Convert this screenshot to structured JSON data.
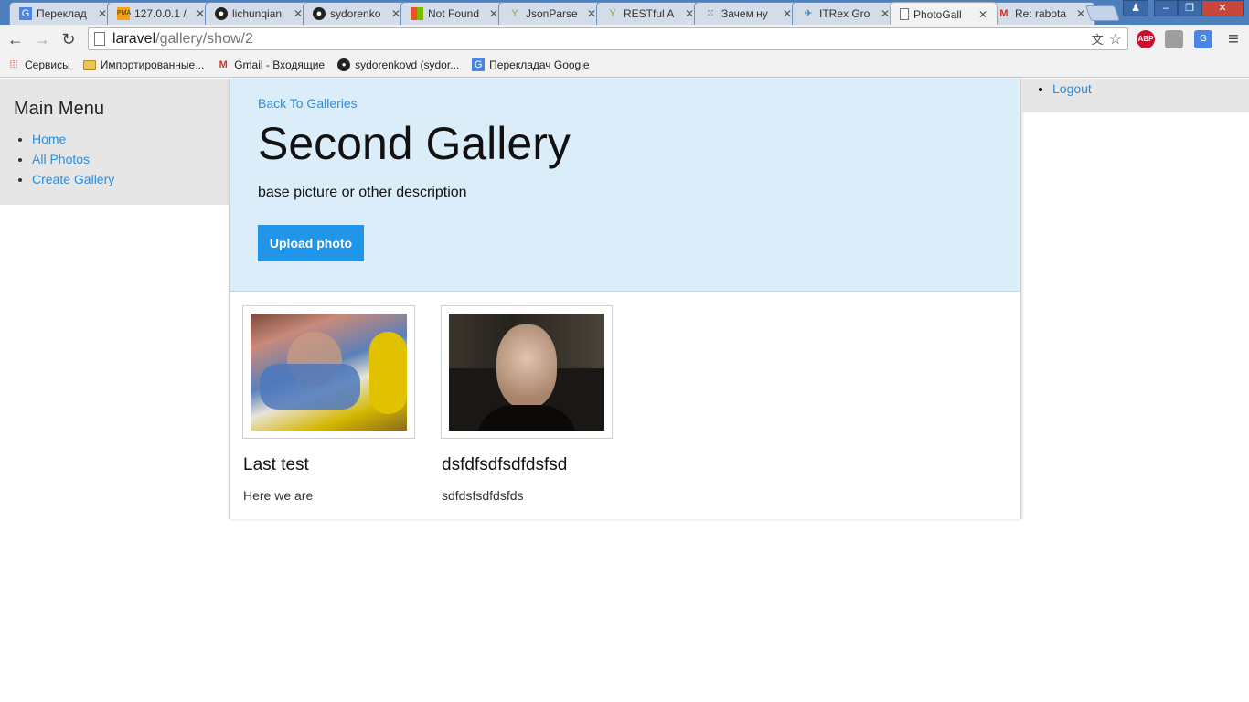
{
  "browser": {
    "tabs": [
      {
        "title": "Переклад",
        "icon": "google-translate-icon"
      },
      {
        "title": "127.0.0.1 /",
        "icon": "phpmyadmin-icon"
      },
      {
        "title": "lichunqian",
        "icon": "github-icon"
      },
      {
        "title": "sydorenko",
        "icon": "github-icon"
      },
      {
        "title": "Not Found",
        "icon": "microsoft-icon"
      },
      {
        "title": "JsonParse",
        "icon": "yii-icon"
      },
      {
        "title": "RESTful A",
        "icon": "yii-icon"
      },
      {
        "title": "Зачем ну",
        "icon": "habr-icon"
      },
      {
        "title": "ITRex Gro",
        "icon": "itrex-icon"
      },
      {
        "title": "PhotoGall",
        "icon": "page-icon"
      },
      {
        "title": "Re: rabota",
        "icon": "gmail-icon"
      }
    ],
    "active_tab_index": 9,
    "url_host": "laravel",
    "url_path": "/gallery/show/2",
    "bookmarks": [
      {
        "label": "Сервисы",
        "icon": "apps-icon"
      },
      {
        "label": "Импортированные...",
        "icon": "folder-icon"
      },
      {
        "label": "Gmail - Входящие",
        "icon": "gmail-icon"
      },
      {
        "label": "sydorenkovd (sydor...",
        "icon": "github-icon"
      },
      {
        "label": "Перекладач Google",
        "icon": "google-translate-icon"
      }
    ],
    "extensions": {
      "adblock": "ABP"
    }
  },
  "sidebar": {
    "title": "Main Menu",
    "items": [
      {
        "label": "Home"
      },
      {
        "label": "All Photos"
      },
      {
        "label": "Create Gallery"
      }
    ]
  },
  "right_panel": {
    "logout_label": "Logout"
  },
  "gallery": {
    "back_label": "Back To Galleries",
    "title": "Second Gallery",
    "description": "base picture or other description",
    "upload_label": "Upload photo",
    "photos": [
      {
        "title": "Last test",
        "description": "Here we are"
      },
      {
        "title": "dsfdfsdfsdfdsfsd",
        "description": "sdfdsfsdfdsfds"
      }
    ]
  },
  "colors": {
    "link": "#2a8ee0",
    "hero_bg": "#dcedfa",
    "button": "#2196e8",
    "sidebar_bg": "#e6e6e6"
  }
}
